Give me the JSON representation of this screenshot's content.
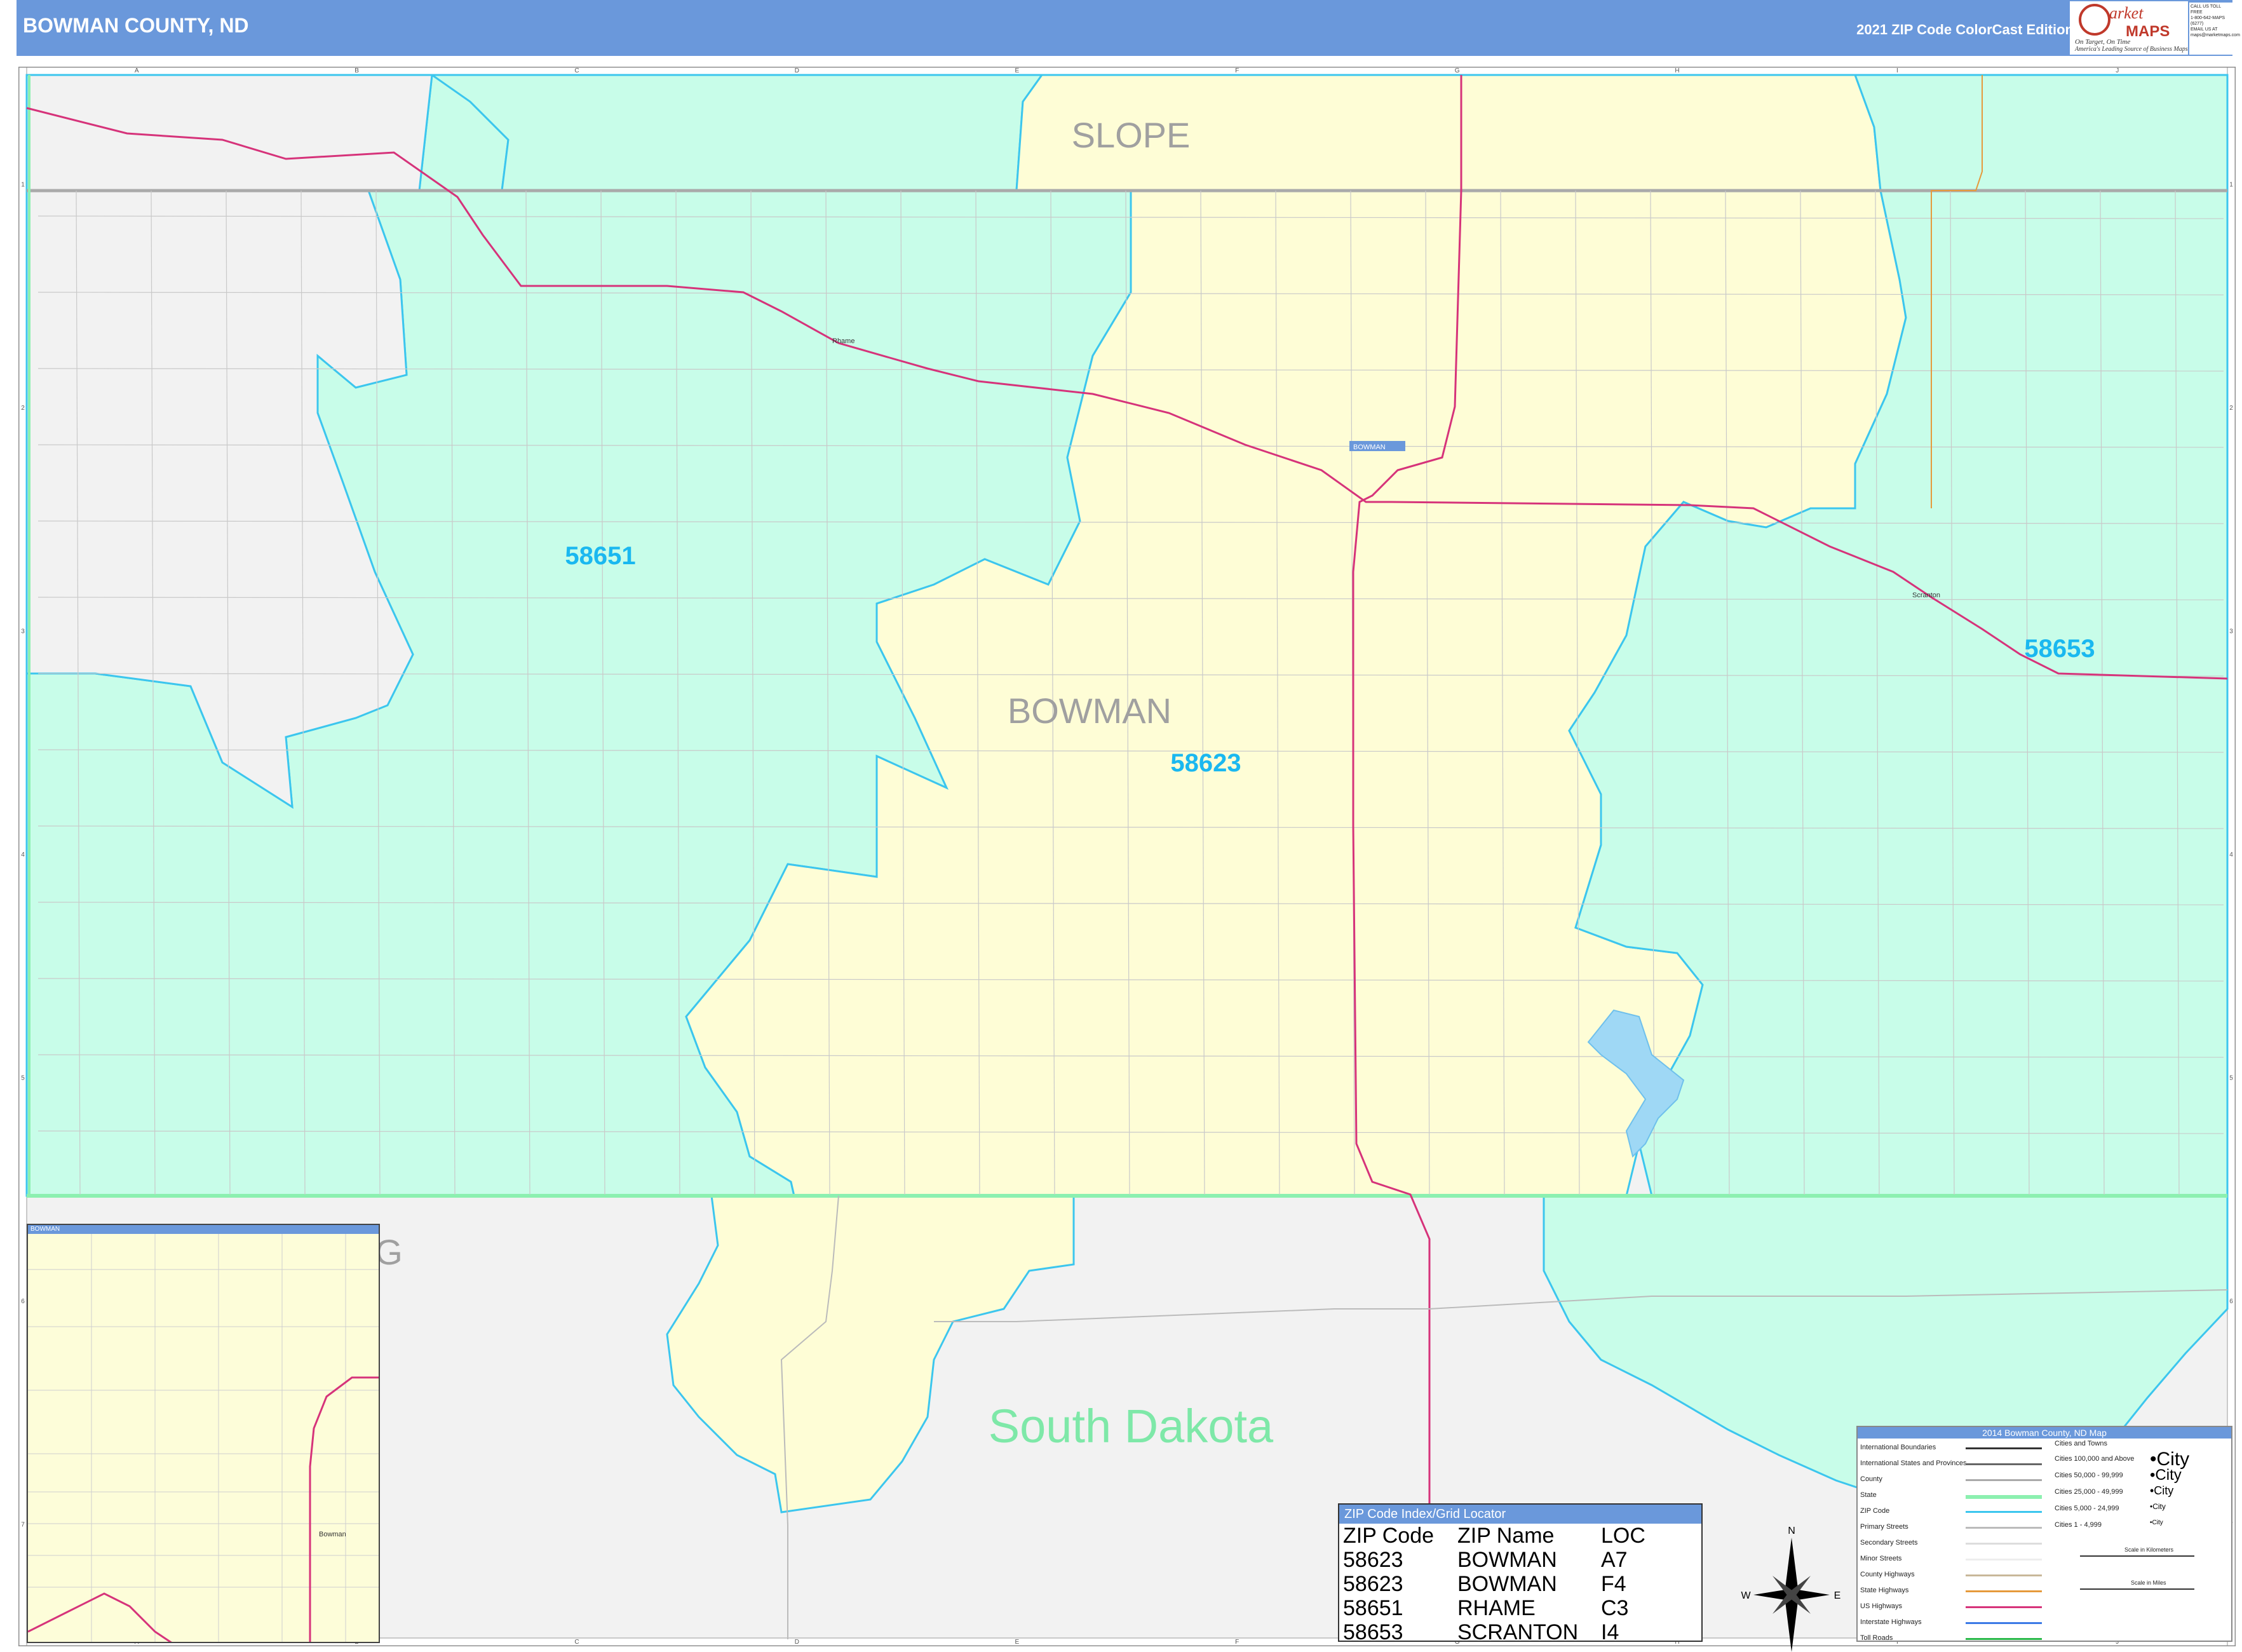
{
  "header": {
    "title": "BOWMAN COUNTY, ND",
    "edition": "2021 ZIP Code ColorCast Edition"
  },
  "logo": {
    "line1": "arket",
    "line2": "MAPS",
    "tagline1": "On Target, On Time",
    "tagline2": "America's Leading Source of Business Maps"
  },
  "contact": {
    "l1": "CALL US TOLL FREE",
    "l2": "1-800-642-MAPS (6277)",
    "l3": "EMAIL US AT",
    "l4": "maps@marketmaps.com"
  },
  "grid": {
    "columns": [
      "A",
      "B",
      "C",
      "D",
      "E",
      "F",
      "G",
      "H",
      "I",
      "J"
    ],
    "rows": [
      "1",
      "2",
      "3",
      "4",
      "5",
      "6",
      "7"
    ]
  },
  "map_labels": {
    "slope": "SLOPE",
    "bowman": "BOWMAN",
    "south_dakota": "South Dakota",
    "partial_g": "G",
    "city_bowman": "BOWMAN",
    "city_rhame": "Rhame",
    "city_scranton": "Scranton",
    "inset_bowman": "Bowman"
  },
  "zip_labels": [
    "58651",
    "58623",
    "58653"
  ],
  "colors": {
    "header": "#6a98db",
    "zip_58651": "#c8fde9",
    "zip_58653": "#c8fde9",
    "zip_58623": "#fefdd6",
    "outside": "#f2f2f2",
    "zip_boundary": "#3cc6ee",
    "state_line": "#8cf0b0",
    "us_highway": "#d6337a",
    "zip_label": "#1ab8f0",
    "county_label": "#a0a0a0",
    "state_label": "#7ee8a8"
  },
  "zip_index": {
    "title": "ZIP Code Index/Grid Locator",
    "headers": [
      "ZIP Code",
      "ZIP Name",
      "LOC"
    ],
    "rows": [
      [
        "58623",
        "BOWMAN",
        "A7"
      ],
      [
        "58623",
        "BOWMAN",
        "F4"
      ],
      [
        "58651",
        "RHAME",
        "C3"
      ],
      [
        "58653",
        "SCRANTON",
        "I4"
      ]
    ]
  },
  "legend": {
    "title": "2014 Bowman County, ND Map",
    "items": [
      "International Boundaries",
      "International States and Provinces",
      "County",
      "State",
      "ZIP Code",
      "Primary Streets",
      "Secondary Streets",
      "Minor Streets",
      "County Highways",
      "State Highways",
      "US Highways",
      "Interstate Highways",
      "Toll Roads"
    ],
    "cities_header": "Cities and Towns",
    "cities": [
      [
        "Cities 100,000 and Above",
        "•City"
      ],
      [
        "Cities 50,000 - 99,999",
        "•City"
      ],
      [
        "Cities 25,000 - 49,999",
        "•City"
      ],
      [
        "Cities 5,000 - 24,999",
        "•City"
      ],
      [
        "Cities 1 - 4,999",
        "•City"
      ]
    ],
    "scale_km": "Scale in Kilometers",
    "scale_mi": "Scale in Miles"
  },
  "compass": {
    "n": "N",
    "s": "S",
    "e": "E",
    "w": "W"
  },
  "inset": {
    "title": "BOWMAN"
  }
}
